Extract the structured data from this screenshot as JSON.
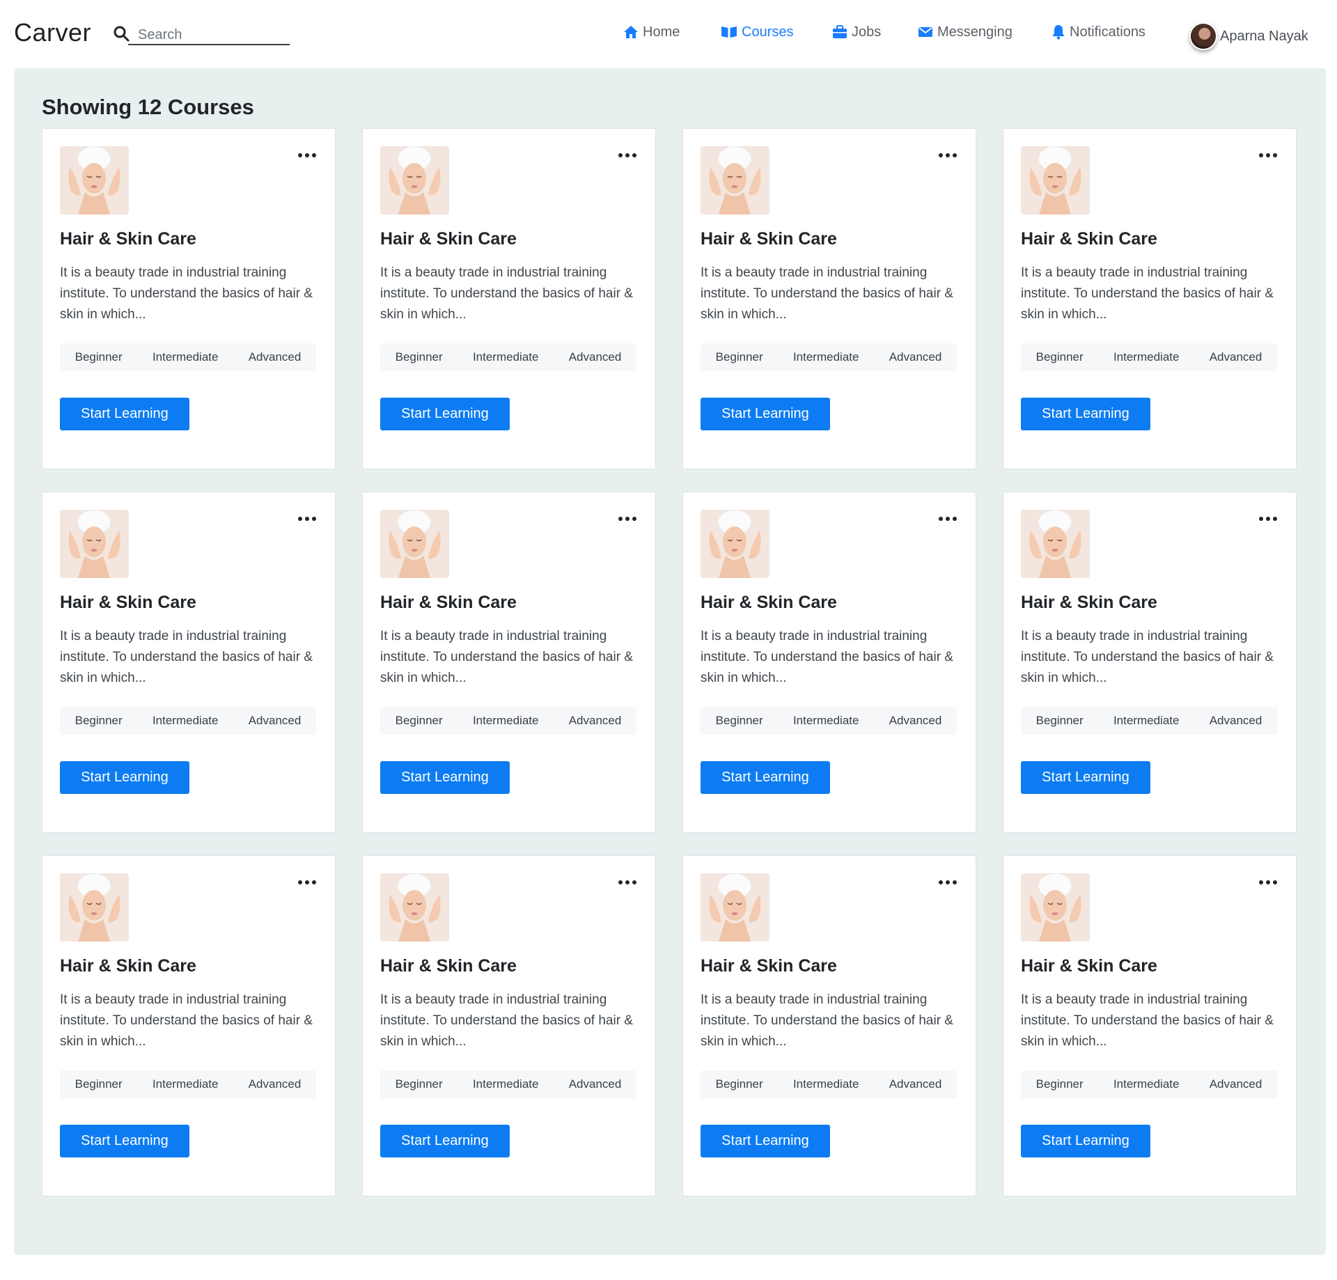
{
  "app": {
    "brand": "Carver"
  },
  "search": {
    "placeholder": "Search",
    "value": ""
  },
  "nav": {
    "home": "Home",
    "courses": "Courses",
    "jobs": "Jobs",
    "messaging": "Messenging",
    "notifications": "Notifications",
    "active": "courses"
  },
  "user": {
    "name": "Aparna Nayak"
  },
  "colors": {
    "accent": "#0d7cf2",
    "panel_bg": "#e8efef"
  },
  "main": {
    "heading": "Showing 12 Courses"
  },
  "courses": [
    {
      "title": "Hair & Skin Care",
      "description": "It is a beauty trade in industrial training institute. To understand the basics of hair & skin in which...",
      "levels": [
        "Beginner",
        "Intermediate",
        "Advanced"
      ],
      "cta": "Start Learning",
      "image_icon": "woman-face-spa-image"
    },
    {
      "title": "Hair & Skin Care",
      "description": "It is a beauty trade in industrial training institute. To understand the basics of hair & skin in which...",
      "levels": [
        "Beginner",
        "Intermediate",
        "Advanced"
      ],
      "cta": "Start Learning",
      "image_icon": "woman-face-spa-image"
    },
    {
      "title": "Hair & Skin Care",
      "description": "It is a beauty trade in industrial training institute. To understand the basics of hair & skin in which...",
      "levels": [
        "Beginner",
        "Intermediate",
        "Advanced"
      ],
      "cta": "Start Learning",
      "image_icon": "woman-face-spa-image"
    },
    {
      "title": "Hair & Skin Care",
      "description": "It is a beauty trade in industrial training institute. To understand the basics of hair & skin in which...",
      "levels": [
        "Beginner",
        "Intermediate",
        "Advanced"
      ],
      "cta": "Start Learning",
      "image_icon": "woman-face-spa-image"
    },
    {
      "title": "Hair & Skin Care",
      "description": "It is a beauty trade in industrial training institute. To understand the basics of hair & skin in which...",
      "levels": [
        "Beginner",
        "Intermediate",
        "Advanced"
      ],
      "cta": "Start Learning",
      "image_icon": "woman-face-spa-image"
    },
    {
      "title": "Hair & Skin Care",
      "description": "It is a beauty trade in industrial training institute. To understand the basics of hair & skin in which...",
      "levels": [
        "Beginner",
        "Intermediate",
        "Advanced"
      ],
      "cta": "Start Learning",
      "image_icon": "woman-face-spa-image"
    },
    {
      "title": "Hair & Skin Care",
      "description": "It is a beauty trade in industrial training institute. To understand the basics of hair & skin in which...",
      "levels": [
        "Beginner",
        "Intermediate",
        "Advanced"
      ],
      "cta": "Start Learning",
      "image_icon": "woman-face-spa-image"
    },
    {
      "title": "Hair & Skin Care",
      "description": "It is a beauty trade in industrial training institute. To understand the basics of hair & skin in which...",
      "levels": [
        "Beginner",
        "Intermediate",
        "Advanced"
      ],
      "cta": "Start Learning",
      "image_icon": "woman-face-spa-image"
    },
    {
      "title": "Hair & Skin Care",
      "description": "It is a beauty trade in industrial training institute. To understand the basics of hair & skin in which...",
      "levels": [
        "Beginner",
        "Intermediate",
        "Advanced"
      ],
      "cta": "Start Learning",
      "image_icon": "woman-face-spa-image"
    },
    {
      "title": "Hair & Skin Care",
      "description": "It is a beauty trade in industrial training institute. To understand the basics of hair & skin in which...",
      "levels": [
        "Beginner",
        "Intermediate",
        "Advanced"
      ],
      "cta": "Start Learning",
      "image_icon": "woman-face-spa-image"
    },
    {
      "title": "Hair & Skin Care",
      "description": "It is a beauty trade in industrial training institute. To understand the basics of hair & skin in which...",
      "levels": [
        "Beginner",
        "Intermediate",
        "Advanced"
      ],
      "cta": "Start Learning",
      "image_icon": "woman-face-spa-image"
    },
    {
      "title": "Hair & Skin Care",
      "description": "It is a beauty trade in industrial training institute. To understand the basics of hair & skin in which...",
      "levels": [
        "Beginner",
        "Intermediate",
        "Advanced"
      ],
      "cta": "Start Learning",
      "image_icon": "woman-face-spa-image"
    }
  ]
}
